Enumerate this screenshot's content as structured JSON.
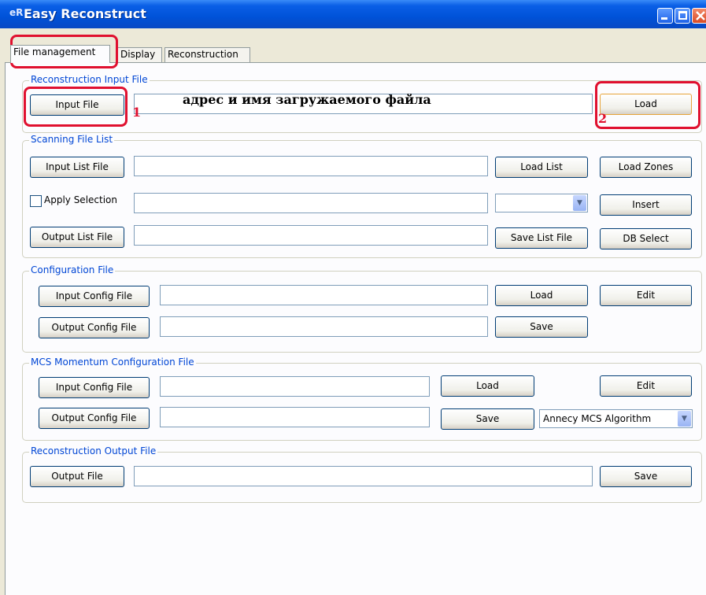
{
  "window": {
    "title": "Easy Reconstruct",
    "app_icon": "app-icon"
  },
  "tabs": [
    {
      "label": "File management",
      "active": true
    },
    {
      "label": "Display",
      "active": false
    },
    {
      "label": "Reconstruction",
      "active": false
    }
  ],
  "groups": {
    "reconstruction_input": {
      "label": "Reconstruction Input File",
      "input_file_button": "Input File",
      "path_value": "",
      "load_button": "Load"
    },
    "scanning_list": {
      "label": "Scanning File List",
      "input_list_button": "Input List File",
      "load_list_button": "Load List",
      "load_zones_button": "Load Zones",
      "apply_selection_label": "Apply Selection",
      "apply_selection_checked": false,
      "selection_combo_value": "",
      "insert_button": "Insert",
      "output_list_button": "Output List File",
      "save_list_button": "Save List File",
      "db_select_button": "DB Select"
    },
    "configuration": {
      "label": "Configuration File",
      "input_config_button": "Input Config File",
      "load_button": "Load",
      "edit_button": "Edit",
      "output_config_button": "Output Config File",
      "save_button": "Save"
    },
    "mcs": {
      "label": "MCS Momentum Configuration File",
      "input_config_button": "Input Config File",
      "load_button": "Load",
      "edit_button": "Edit",
      "output_config_button": "Output Config File",
      "save_button": "Save",
      "algorithm_value": "Annecy MCS Algorithm"
    },
    "reconstruction_output": {
      "label": "Reconstruction Output File",
      "output_file_button": "Output File",
      "save_button": "Save"
    }
  },
  "annotations": {
    "caption": "адрес и имя загружаемого файла",
    "marker_1": "1",
    "marker_2": "2",
    "color": "#e0102f"
  }
}
